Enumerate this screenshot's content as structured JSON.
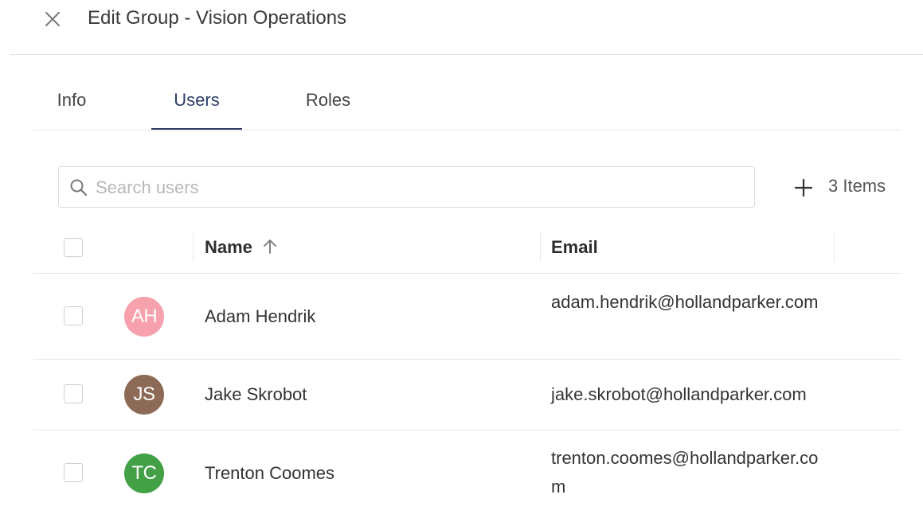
{
  "header": {
    "title": "Edit Group - Vision Operations"
  },
  "tabs": [
    {
      "label": "Info",
      "active": false
    },
    {
      "label": "Users",
      "active": true
    },
    {
      "label": "Roles",
      "active": false
    }
  ],
  "search": {
    "placeholder": "Search users",
    "value": ""
  },
  "toolbar": {
    "items_count": "3 Items"
  },
  "table": {
    "columns": {
      "name": "Name",
      "email": "Email"
    },
    "sort": {
      "column": "name",
      "direction": "ascending"
    },
    "rows": [
      {
        "initials": "AH",
        "avatar_color": "#f7a1ad",
        "name": "Adam Hendrik",
        "email": "adam.hendrik@hollandparker.com"
      },
      {
        "initials": "JS",
        "avatar_color": "#8c6a55",
        "name": "Jake Skrobot",
        "email": "jake.skrobot@hollandparker.com"
      },
      {
        "initials": "TC",
        "avatar_color": "#43a047",
        "name": "Trenton Coomes",
        "email": "trenton.coomes@hollandparker.com"
      }
    ]
  },
  "colors": {
    "accent": "#2f3f66",
    "divider": "#e6e6e6"
  }
}
